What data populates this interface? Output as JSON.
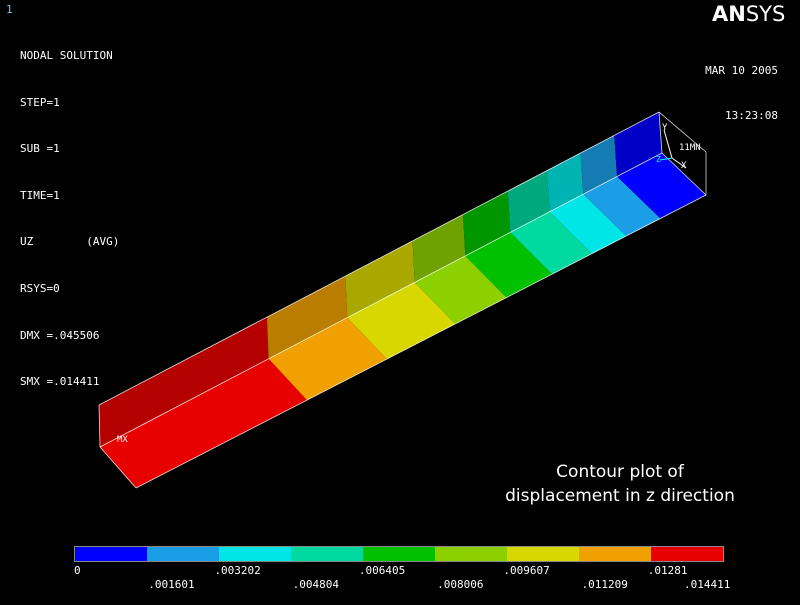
{
  "window_number": "1",
  "info_lines": [
    "NODAL SOLUTION",
    "STEP=1",
    "SUB =1",
    "TIME=1",
    "UZ        (AVG)",
    "RSYS=0",
    "DMX =.045506",
    "SMX =.014411"
  ],
  "date": "MAR 10 2005",
  "time": "13:23:08",
  "logo": {
    "an": "AN",
    "sys": "SYS"
  },
  "caption": {
    "line1": "Contour plot of",
    "line2": "displacement in z direction"
  },
  "model_labels": {
    "mx": "MX",
    "mn": "MN",
    "y": "Y",
    "x": "X",
    "z": "Z",
    "node": "11"
  },
  "legend": {
    "colors": [
      "#0000ff",
      "#1a9ee6",
      "#00e6e6",
      "#00d9a0",
      "#00c000",
      "#8cd000",
      "#d8d800",
      "#f0a000",
      "#e80000"
    ],
    "upper_labels": [
      "0",
      ".003202",
      ".006405",
      ".009607",
      ".01281"
    ],
    "lower_labels": [
      ".001601",
      ".004804",
      ".008006",
      ".011209",
      ".014411"
    ]
  }
}
